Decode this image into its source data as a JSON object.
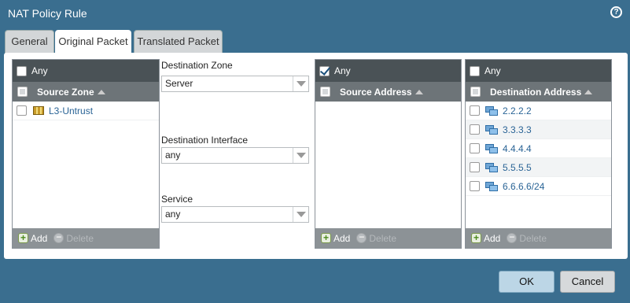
{
  "window": {
    "title": "NAT Policy Rule",
    "help_icon": "question-circle-icon",
    "help_glyph": "?"
  },
  "tabs": [
    {
      "label": "General",
      "active": false
    },
    {
      "label": "Original Packet",
      "active": true
    },
    {
      "label": "Translated Packet",
      "active": false
    }
  ],
  "source_zone": {
    "any_label": "Any",
    "any_checked": false,
    "column_header": "Source Zone",
    "rows": [
      {
        "label": "L3-Untrust",
        "icon": "zone-icon"
      }
    ]
  },
  "destination_zone": {
    "label": "Destination Zone",
    "value": "Server"
  },
  "destination_interface": {
    "label": "Destination Interface",
    "value": "any"
  },
  "service": {
    "label": "Service",
    "value": "any"
  },
  "source_address": {
    "any_label": "Any",
    "any_checked": true,
    "column_header": "Source Address",
    "rows": []
  },
  "destination_address": {
    "any_label": "Any",
    "any_checked": false,
    "column_header": "Destination Address",
    "rows": [
      {
        "label": "2.2.2.2"
      },
      {
        "label": "3.3.3.3"
      },
      {
        "label": "4.4.4.4"
      },
      {
        "label": "5.5.5.5"
      },
      {
        "label": "6.6.6.6/24"
      }
    ]
  },
  "footer": {
    "add_label": "Add",
    "delete_label": "Delete",
    "add_glyph": "+",
    "delete_glyph": "−"
  },
  "buttons": {
    "ok_label": "OK",
    "cancel_label": "Cancel"
  }
}
